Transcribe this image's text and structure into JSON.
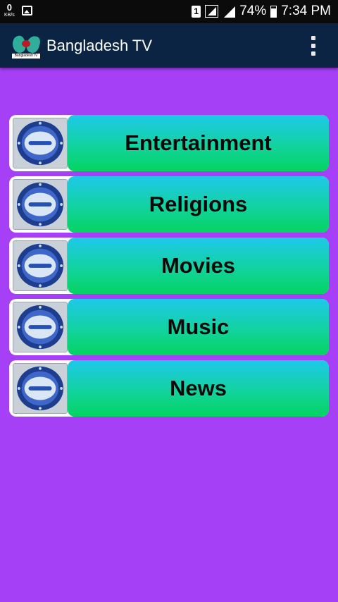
{
  "status_bar": {
    "data_rate": "0",
    "data_unit": "KB/s",
    "sim_slot": "1",
    "battery": "74%",
    "time": "7:34 PM"
  },
  "app_bar": {
    "title": "Bangladesh TV",
    "logo_text": "BangladeshTV"
  },
  "categories": [
    {
      "label": "Entertainment"
    },
    {
      "label": "Religions"
    },
    {
      "label": "Movies"
    },
    {
      "label": "Music"
    },
    {
      "label": "News"
    }
  ],
  "colors": {
    "background": "#a640f6",
    "app_bar": "#0c2444",
    "button_top": "#1ec8ea",
    "button_bottom": "#05d360"
  }
}
